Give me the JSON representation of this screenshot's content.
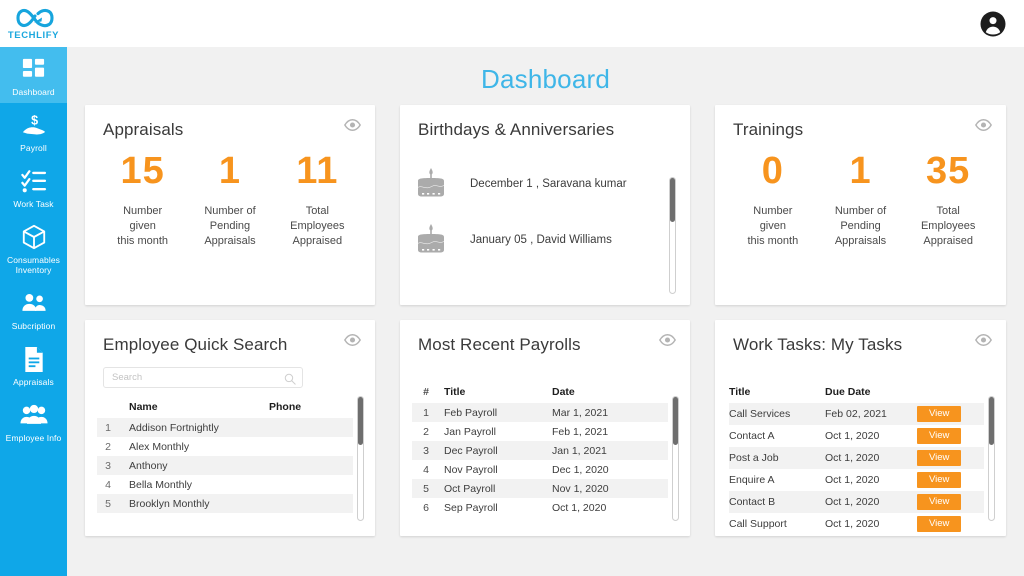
{
  "brand": {
    "name": "TECHLIFY",
    "logo_icon": "infinity-logo-icon",
    "accent_blue": "#0fa7e8",
    "accent_orange": "#f7941e",
    "title_blue": "#3fb6e8"
  },
  "header": {
    "avatar_icon": "account-circle-icon"
  },
  "sidebar": {
    "items": [
      {
        "label": "Dashboard",
        "icon": "grid-dashboard-icon",
        "active": true
      },
      {
        "label": "Payroll",
        "icon": "hand-dollar-icon",
        "active": false
      },
      {
        "label": "Work Task",
        "icon": "checklist-icon",
        "active": false
      },
      {
        "label": "Consumables Inventory",
        "icon": "box-package-icon",
        "active": false
      },
      {
        "label": "Subcription",
        "icon": "people-group-icon",
        "active": false
      },
      {
        "label": "Appraisals",
        "icon": "document-lines-icon",
        "active": false
      },
      {
        "label": "Employee Info",
        "icon": "employees-icon",
        "active": false
      }
    ]
  },
  "page": {
    "title": "Dashboard"
  },
  "cards": {
    "appraisals": {
      "title": "Appraisals",
      "eye_icon": "eye-icon",
      "stats": [
        {
          "value": "15",
          "label": "Number\ngiven\nthis month"
        },
        {
          "value": "1",
          "label": "Number of\nPending\nAppraisals"
        },
        {
          "value": "11",
          "label": "Total\nEmployees\nAppraised"
        }
      ]
    },
    "birthdays": {
      "title": "Birthdays & Anniversaries",
      "items": [
        {
          "icon": "birthday-cake-icon",
          "text": "December 1 , Saravana kumar"
        },
        {
          "icon": "birthday-cake-icon",
          "text": "January 05 , David Williams"
        }
      ]
    },
    "trainings": {
      "title": "Trainings",
      "eye_icon": "eye-icon",
      "stats": [
        {
          "value": "0",
          "label": "Number\ngiven\nthis month"
        },
        {
          "value": "1",
          "label": "Number of\nPending\nAppraisals"
        },
        {
          "value": "35",
          "label": "Total\nEmployees\nAppraised"
        }
      ]
    },
    "employee_search": {
      "title": "Employee Quick Search",
      "eye_icon": "eye-icon",
      "search_placeholder": "Search",
      "search_value": "",
      "search_icon": "search-icon",
      "columns": [
        "",
        "Name",
        "Phone"
      ],
      "rows": [
        {
          "idx": "1",
          "name": "Addison Fortnightly",
          "phone": ""
        },
        {
          "idx": "2",
          "name": "Alex Monthly",
          "phone": ""
        },
        {
          "idx": "3",
          "name": "Anthony",
          "phone": ""
        },
        {
          "idx": "4",
          "name": "Bella Monthly",
          "phone": ""
        },
        {
          "idx": "5",
          "name": "Brooklyn Monthly",
          "phone": ""
        }
      ]
    },
    "payrolls": {
      "title": "Most Recent Payrolls",
      "eye_icon": "eye-icon",
      "columns": [
        "#",
        "Title",
        "Date"
      ],
      "rows": [
        {
          "idx": "1",
          "title": "Feb Payroll",
          "date": "Mar 1, 2021"
        },
        {
          "idx": "2",
          "title": "Jan Payroll",
          "date": "Feb  1, 2021"
        },
        {
          "idx": "3",
          "title": "Dec Payroll",
          "date": "Jan 1, 2021"
        },
        {
          "idx": "4",
          "title": "Nov Payroll",
          "date": "Dec 1, 2020"
        },
        {
          "idx": "5",
          "title": "Oct Payroll",
          "date": "Nov 1, 2020"
        },
        {
          "idx": "6",
          "title": "Sep Payroll",
          "date": "Oct 1, 2020"
        }
      ]
    },
    "work_tasks": {
      "title": "Work Tasks: My Tasks",
      "eye_icon": "eye-icon",
      "columns": [
        "Title",
        "Due Date",
        ""
      ],
      "action_label": "View",
      "rows": [
        {
          "title": "Call Services",
          "due": "Feb 02, 2021"
        },
        {
          "title": "Contact  A",
          "due": "Oct 1, 2020"
        },
        {
          "title": "Post a Job",
          "due": "Oct 1, 2020"
        },
        {
          "title": "Enquire A",
          "due": "Oct 1, 2020"
        },
        {
          "title": "Contact B",
          "due": "Oct 1, 2020"
        },
        {
          "title": "Call Support",
          "due": "Oct 1, 2020"
        }
      ]
    }
  }
}
